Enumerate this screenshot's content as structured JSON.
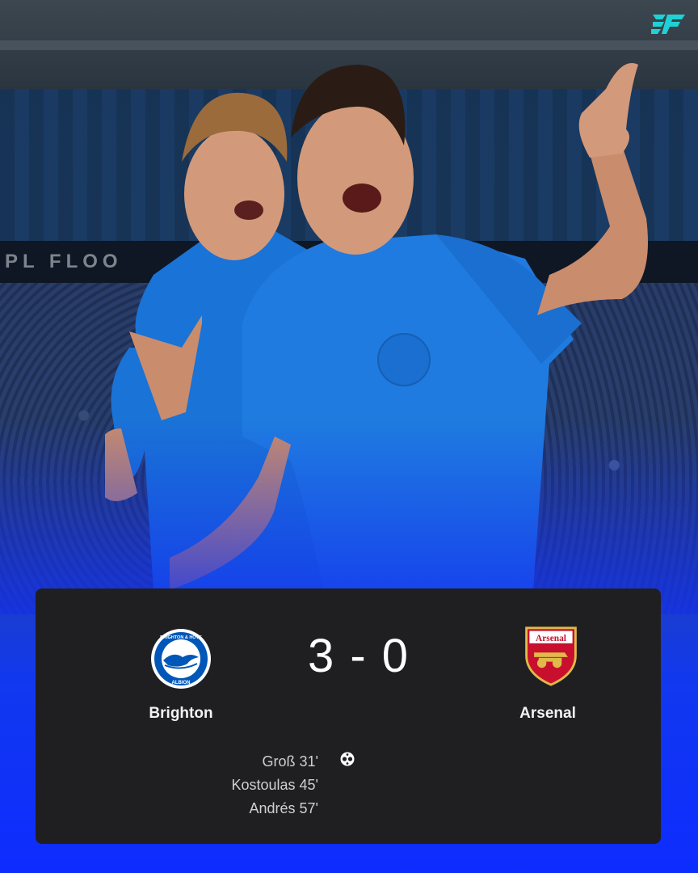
{
  "brand": {
    "logo_text": "3F",
    "logo_color": "#1fd1d6"
  },
  "photo": {
    "banner_text": "PL FLOO"
  },
  "match": {
    "home": {
      "name": "Brighton",
      "badge_ring_text": "BRIGHTON & HOVE",
      "badge_bottom_text": "ALBION",
      "color": "#0057b8"
    },
    "away": {
      "name": "Arsenal",
      "badge_text": "Arsenal",
      "color": "#db0007"
    },
    "score": "3 - 0",
    "scorers": [
      {
        "text": "Groß 31'"
      },
      {
        "text": "Kostoulas 45'"
      },
      {
        "text": "Andrés 57'"
      }
    ],
    "goal_icon": "football-icon"
  }
}
